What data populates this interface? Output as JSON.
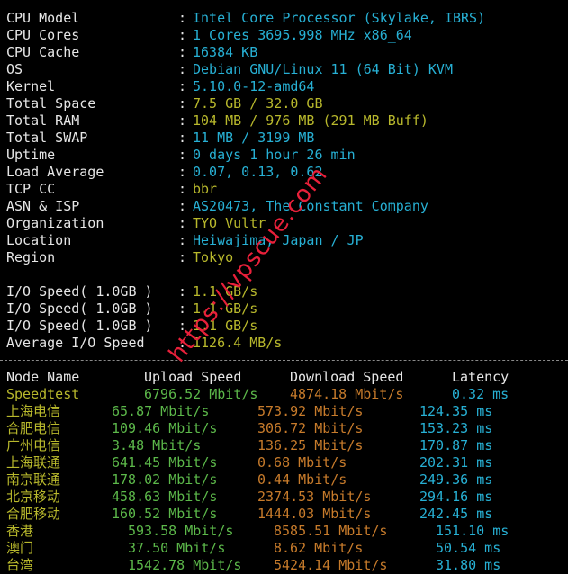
{
  "colors": {
    "background": "#000000",
    "label": "#e6e6e6",
    "value_cyan": "#27b0d4",
    "value_yellow": "#b8b82c",
    "value_green": "#5cb84a",
    "value_orange": "#c77b2b",
    "separator": "#8a8a8a",
    "watermark": "#e8203a"
  },
  "system_info": [
    {
      "label": "CPU Model",
      "value": "Intel Core Processor (Skylake, IBRS)",
      "color": "#27b0d4"
    },
    {
      "label": "CPU Cores",
      "value": "1 Cores 3695.998 MHz x86_64",
      "color": "#27b0d4"
    },
    {
      "label": "CPU Cache",
      "value": "16384 KB",
      "color": "#27b0d4"
    },
    {
      "label": "OS",
      "value": "Debian GNU/Linux 11 (64 Bit) KVM",
      "color": "#27b0d4"
    },
    {
      "label": "Kernel",
      "value": "5.10.0-12-amd64",
      "color": "#27b0d4"
    },
    {
      "label": "Total Space",
      "value": "7.5 GB / 32.0 GB",
      "color": "#b8b82c"
    },
    {
      "label": "Total RAM",
      "value": "104 MB / 976 MB (291 MB Buff)",
      "color": "#b8b82c"
    },
    {
      "label": "Total SWAP",
      "value": "11 MB / 3199 MB",
      "color": "#27b0d4"
    },
    {
      "label": "Uptime",
      "value": "0 days 1 hour 26 min",
      "color": "#27b0d4"
    },
    {
      "label": "Load Average",
      "value": "0.07, 0.13, 0.62",
      "color": "#27b0d4"
    },
    {
      "label": "TCP CC",
      "value": "bbr",
      "color": "#b8b82c"
    },
    {
      "label": "ASN & ISP",
      "value": "AS20473, The Constant Company",
      "color": "#27b0d4"
    },
    {
      "label": "Organization",
      "value": "TYO Vultr",
      "color": "#b8b82c"
    },
    {
      "label": "Location",
      "value": "Heiwajima, Japan / JP",
      "color": "#27b0d4"
    },
    {
      "label": "Region",
      "value": "Tokyo",
      "color": "#b8b82c"
    }
  ],
  "io_speed": [
    {
      "label": "I/O Speed( 1.0GB )",
      "value": "1.1 GB/s"
    },
    {
      "label": "I/O Speed( 1.0GB )",
      "value": "1.1 GB/s"
    },
    {
      "label": "I/O Speed( 1.0GB )",
      "value": "1.1 GB/s"
    },
    {
      "label": "Average I/O Speed",
      "value": "1126.4 MB/s"
    }
  ],
  "speedtest": {
    "headers": {
      "node": "Node Name",
      "upload": "Upload Speed",
      "download": "Download Speed",
      "latency": "Latency"
    },
    "rows": [
      {
        "node": "Speedtest",
        "upload": "6796.52 Mbit/s",
        "download": "4874.18 Mbit/s",
        "latency": "0.32 ms"
      },
      {
        "node": "上海电信",
        "upload": "65.87 Mbit/s",
        "download": "573.92 Mbit/s",
        "latency": "124.35 ms"
      },
      {
        "node": "合肥电信",
        "upload": "109.46 Mbit/s",
        "download": "306.72 Mbit/s",
        "latency": "153.23 ms"
      },
      {
        "node": "广州电信",
        "upload": "3.48 Mbit/s",
        "download": "136.25 Mbit/s",
        "latency": "170.87 ms"
      },
      {
        "node": "上海联通",
        "upload": "641.45 Mbit/s",
        "download": "0.68 Mbit/s",
        "latency": "202.31 ms"
      },
      {
        "node": "南京联通",
        "upload": "178.02 Mbit/s",
        "download": "0.44 Mbit/s",
        "latency": "249.36 ms"
      },
      {
        "node": "北京移动",
        "upload": "458.63 Mbit/s",
        "download": "2374.53 Mbit/s",
        "latency": "294.16 ms"
      },
      {
        "node": "合肥移动",
        "upload": "160.52 Mbit/s",
        "download": "1444.03 Mbit/s",
        "latency": "242.45 ms"
      },
      {
        "node": "香港",
        "upload": "593.58 Mbit/s",
        "download": "8585.51 Mbit/s",
        "latency": "151.10 ms"
      },
      {
        "node": "澳门",
        "upload": "37.50 Mbit/s",
        "download": "8.62 Mbit/s",
        "latency": "50.54 ms"
      },
      {
        "node": "台湾",
        "upload": "1542.78 Mbit/s",
        "download": "5424.14 Mbit/s",
        "latency": "31.80 ms"
      }
    ]
  },
  "watermark": {
    "text": "https://vpscue.com"
  }
}
